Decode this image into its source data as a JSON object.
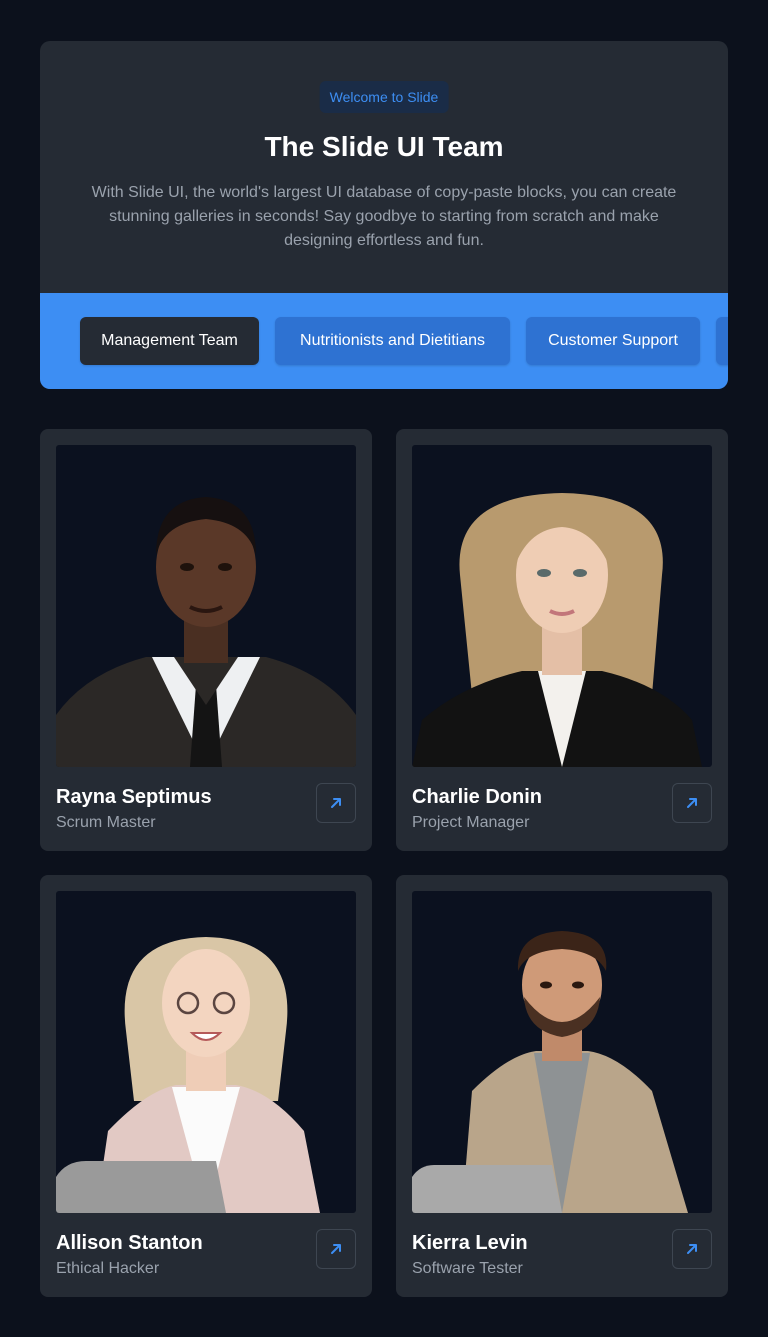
{
  "hero": {
    "badge": "Welcome to Slide",
    "title": "The Slide UI Team",
    "description": "With Slide UI, the world's largest UI database of copy-paste blocks, you can create stunning galleries in seconds! Say goodbye to starting from scratch and make designing effortless and fun."
  },
  "tabs": [
    {
      "label": "Management Team",
      "active": true
    },
    {
      "label": "Nutritionists and Dietitians",
      "active": false
    },
    {
      "label": "Customer Support",
      "active": false
    },
    {
      "label": "",
      "active": false
    }
  ],
  "team": [
    {
      "name": "Rayna Septimus",
      "role": "Scrum Master",
      "icon": "arrow-up-right-icon"
    },
    {
      "name": "Charlie Donin",
      "role": "Project Manager",
      "icon": "arrow-up-right-icon"
    },
    {
      "name": "Allison Stanton",
      "role": "Ethical Hacker",
      "icon": "arrow-up-right-icon"
    },
    {
      "name": "Kierra Levin",
      "role": "Software Tester",
      "icon": "arrow-up-right-icon"
    }
  ],
  "colors": {
    "background": "#0c111c",
    "card": "#252b34",
    "accent": "#3d8ef3",
    "tab_inactive": "#2e72d2",
    "muted_text": "#9aa2ad"
  }
}
